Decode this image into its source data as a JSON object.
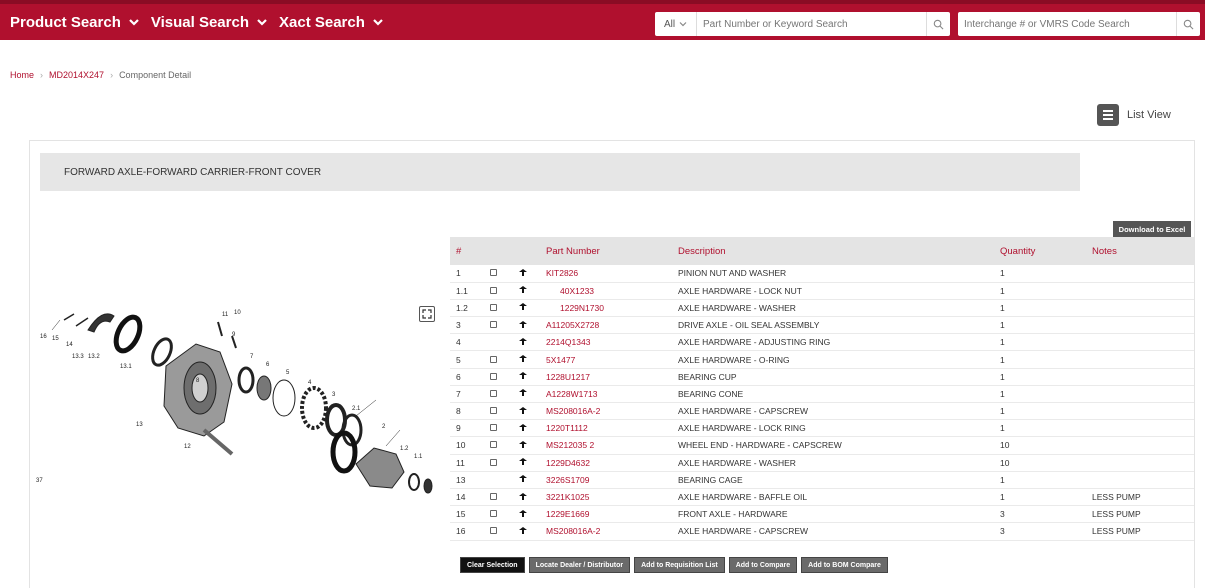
{
  "nav": {
    "items": [
      {
        "label": "Product Search"
      },
      {
        "label": "Visual Search"
      },
      {
        "label": "Xact Search"
      }
    ]
  },
  "search": {
    "scope": "All",
    "placeholder": "Part Number or Keyword Search",
    "interchange_placeholder": "Interchange # or VMRS Code Search"
  },
  "breadcrumb": {
    "home": "Home",
    "model": "MD2014X247",
    "current": "Component Detail"
  },
  "view_toggle": {
    "label": "List View"
  },
  "component": {
    "title": "FORWARD AXLE-FORWARD CARRIER-FRONT COVER"
  },
  "download_label": "Download to Excel",
  "table": {
    "headers": [
      "#",
      "Part Number",
      "Description",
      "Quantity",
      "Notes"
    ],
    "rows": [
      {
        "num": "1",
        "checkbox": true,
        "part": "KIT2826",
        "desc": "PINION NUT AND WASHER",
        "qty": "1",
        "notes": ""
      },
      {
        "num": "1.1",
        "checkbox": true,
        "part": "40X1233",
        "desc": "AXLE HARDWARE - LOCK NUT",
        "qty": "1",
        "notes": ""
      },
      {
        "num": "1.2",
        "checkbox": true,
        "part": "1229N1730",
        "desc": "AXLE HARDWARE - WASHER",
        "qty": "1",
        "notes": ""
      },
      {
        "num": "3",
        "checkbox": true,
        "part": "A11205X2728",
        "desc": "DRIVE AXLE - OIL SEAL ASSEMBLY",
        "qty": "1",
        "notes": ""
      },
      {
        "num": "4",
        "checkbox": false,
        "part": "2214Q1343",
        "desc": "AXLE HARDWARE - ADJUSTING RING",
        "qty": "1",
        "notes": ""
      },
      {
        "num": "5",
        "checkbox": true,
        "part": "5X1477",
        "desc": "AXLE HARDWARE - O-RING",
        "qty": "1",
        "notes": ""
      },
      {
        "num": "6",
        "checkbox": true,
        "part": "1228U1217",
        "desc": "BEARING CUP",
        "qty": "1",
        "notes": ""
      },
      {
        "num": "7",
        "checkbox": true,
        "part": "A1228W1713",
        "desc": "BEARING CONE",
        "qty": "1",
        "notes": ""
      },
      {
        "num": "8",
        "checkbox": true,
        "part": "MS208016A-2",
        "desc": "AXLE HARDWARE - CAPSCREW",
        "qty": "1",
        "notes": ""
      },
      {
        "num": "9",
        "checkbox": true,
        "part": "1220T1112",
        "desc": "AXLE HARDWARE - LOCK RING",
        "qty": "1",
        "notes": ""
      },
      {
        "num": "10",
        "checkbox": true,
        "part": "MS212035 2",
        "desc": "WHEEL END - HARDWARE - CAPSCREW",
        "qty": "10",
        "notes": ""
      },
      {
        "num": "11",
        "checkbox": true,
        "part": "1229D4632",
        "desc": "AXLE HARDWARE - WASHER",
        "qty": "10",
        "notes": ""
      },
      {
        "num": "13",
        "checkbox": false,
        "part": "3226S1709",
        "desc": "BEARING CAGE",
        "qty": "1",
        "notes": ""
      },
      {
        "num": "14",
        "checkbox": true,
        "part": "3221K1025",
        "desc": "AXLE HARDWARE - BAFFLE OIL",
        "qty": "1",
        "notes": "LESS PUMP"
      },
      {
        "num": "15",
        "checkbox": true,
        "part": "1229E1669",
        "desc": "FRONT AXLE - HARDWARE",
        "qty": "3",
        "notes": "LESS PUMP"
      },
      {
        "num": "16",
        "checkbox": true,
        "part": "MS208016A-2",
        "desc": "AXLE HARDWARE - CAPSCREW",
        "qty": "3",
        "notes": "LESS PUMP"
      }
    ]
  },
  "actions": [
    {
      "label": "Clear Selection",
      "style": "dark"
    },
    {
      "label": "Locate Dealer / Distributor",
      "style": "grey"
    },
    {
      "label": "Add to Requisition List",
      "style": "grey"
    },
    {
      "label": "Add to Compare",
      "style": "grey"
    },
    {
      "label": "Add to BOM Compare",
      "style": "grey"
    }
  ],
  "diagram": {
    "callouts": [
      "16",
      "15",
      "14",
      "13.3",
      "13.2",
      "13.1",
      "13",
      "12",
      "11",
      "10",
      "9",
      "8",
      "7",
      "6",
      "5",
      "4",
      "3",
      "2.1",
      "2",
      "1.2",
      "1.1",
      "37"
    ]
  },
  "colors": {
    "brand": "#b0102e",
    "header_bg": "#e4e4e4"
  }
}
